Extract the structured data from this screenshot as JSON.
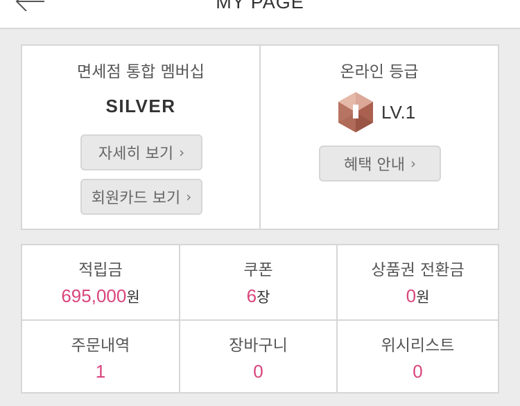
{
  "header": {
    "title": "MY PAGE"
  },
  "membership": {
    "left": {
      "title": "면세점 통합 멤버십",
      "grade": "SILVER",
      "detail_button": "자세히 보기",
      "card_button": "회원카드 보기"
    },
    "right": {
      "title": "온라인 등급",
      "level_label": "LV.1",
      "benefit_button": "혜택 안내"
    }
  },
  "stats": [
    {
      "label": "적립금",
      "value": "695,000",
      "unit": "원"
    },
    {
      "label": "쿠폰",
      "value": "6",
      "unit": "장"
    },
    {
      "label": "상품권 전환금",
      "value": "0",
      "unit": "원"
    },
    {
      "label": "주문내역",
      "value": "1",
      "unit": ""
    },
    {
      "label": "장바구니",
      "value": "0",
      "unit": ""
    },
    {
      "label": "위시리스트",
      "value": "0",
      "unit": ""
    }
  ],
  "colors": {
    "accent": "#d9447c",
    "background": "#ececec",
    "border": "#d6d6d6"
  },
  "icons": {
    "back": "arrow-left-icon",
    "chevron": "chevron-right-icon",
    "level_badge": "hexagon-badge-icon"
  }
}
